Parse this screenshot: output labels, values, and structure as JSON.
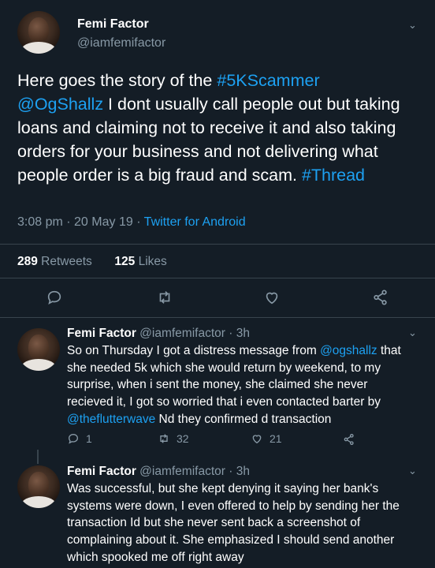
{
  "main_tweet": {
    "name": "Femi Factor",
    "handle": "@iamfemifactor",
    "text_parts": {
      "p1": "Here goes the story of the ",
      "hashtag1": "#5KScammer",
      "mention": "@OgShallz",
      "p2": " I dont usually call people out but taking loans and claiming not to receive it and also taking orders for your business and not delivering what people order is a big fraud and scam. ",
      "hashtag2": "#Thread"
    },
    "time": "3:08 pm · 20 May 19 · ",
    "source": "Twitter for Android",
    "retweets_count": "289",
    "retweets_label": " Retweets",
    "likes_count": "125",
    "likes_label": " Likes"
  },
  "reply1": {
    "name": "Femi Factor",
    "handle": " @iamfemifactor · 3h",
    "text_a": "So on Thursday I got a distress message from ",
    "mention1": "@ogshallz",
    "text_b": " that she needed 5k which she would return by weekend, to my surprise, when i sent the money, she claimed she never recieved it, I got so worried that i even contacted barter by ",
    "mention2": "@theflutterwave",
    "text_c": " Nd they confirmed d transaction",
    "replies": "1",
    "retweets": "32",
    "likes": "21"
  },
  "reply2": {
    "name": "Femi Factor",
    "handle": " @iamfemifactor · 3h",
    "text": "Was successful,  but she kept denying it saying her bank's systems were down, I even offered to help by sending her the transaction Id but she never sent back a screenshot of complaining about it. She emphasized I should send another which spooked me off right away"
  },
  "icons": [
    "chevron-down-icon",
    "reply-icon",
    "retweet-icon",
    "like-icon",
    "share-icon"
  ],
  "colors": {
    "background": "#141d26",
    "accent": "#1da1f2",
    "muted": "#8899a6",
    "divider": "#38444d"
  }
}
